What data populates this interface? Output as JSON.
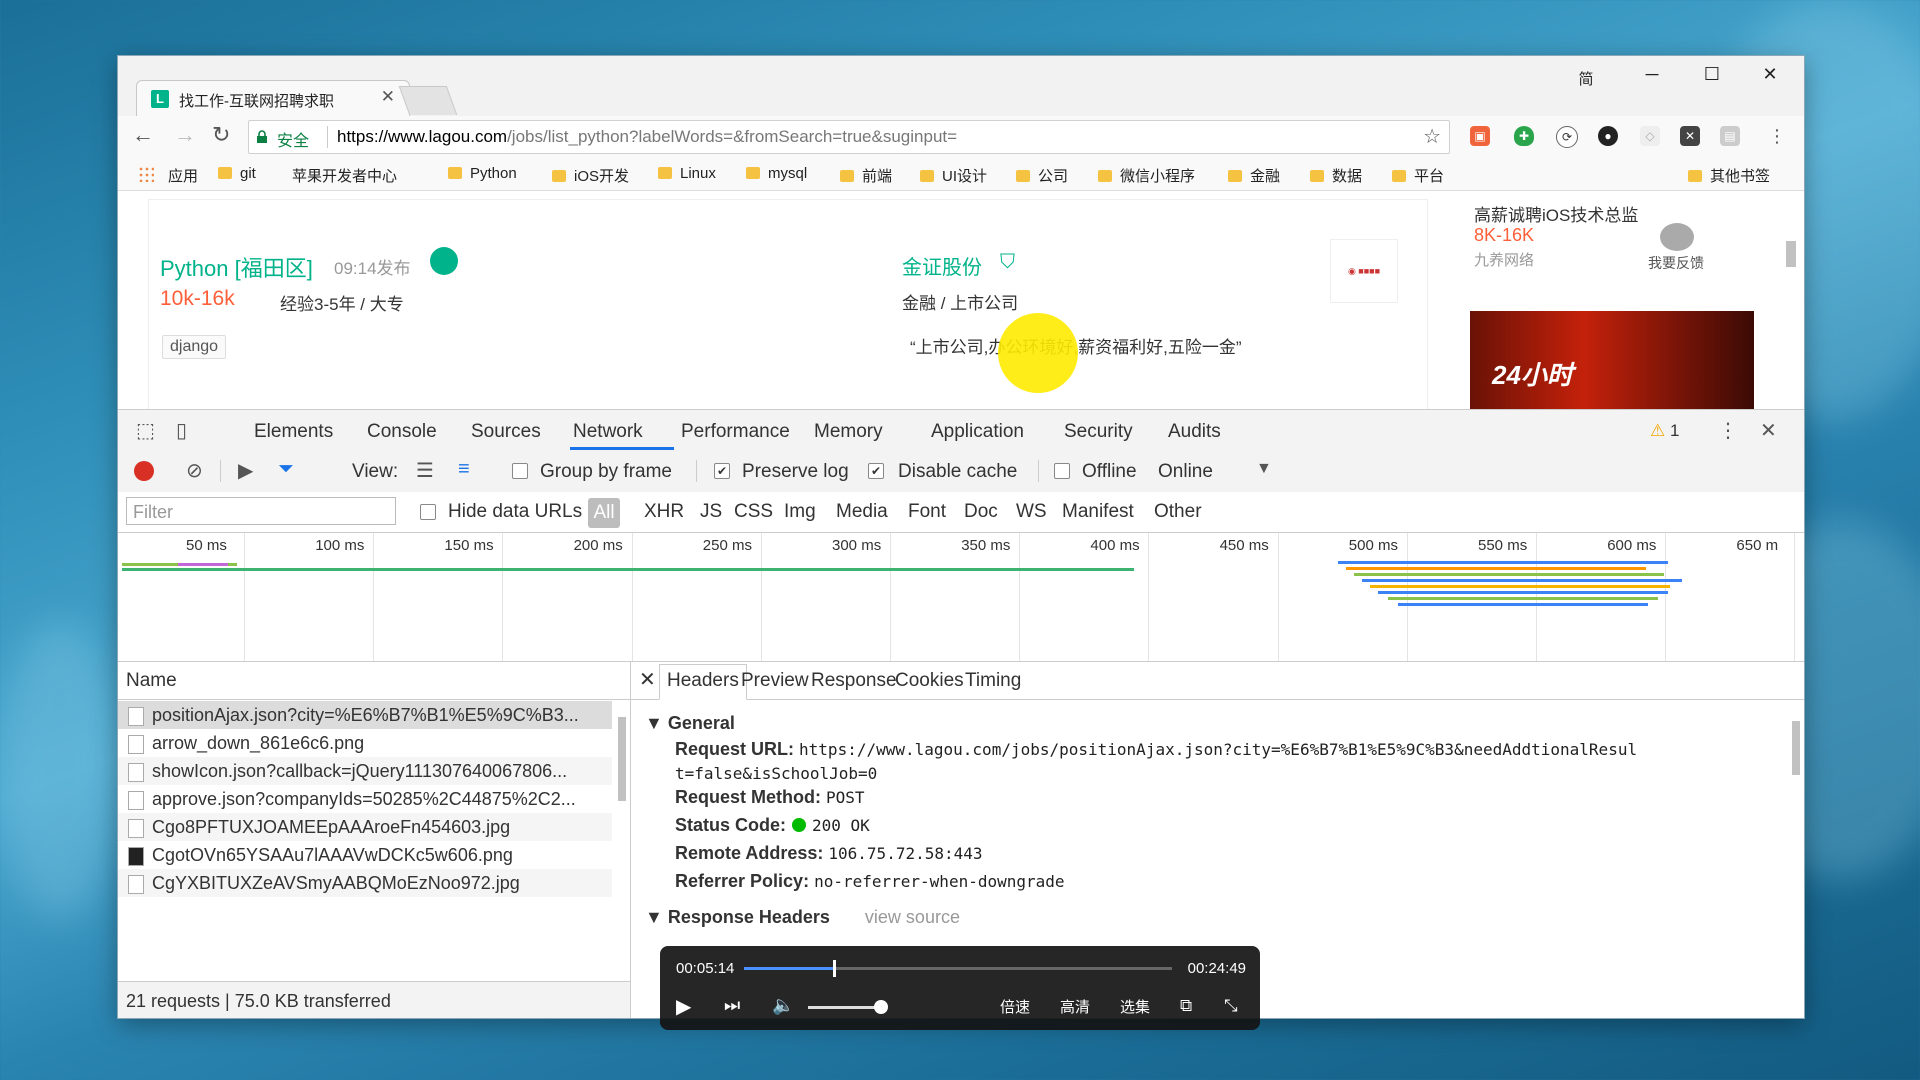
{
  "browser": {
    "tab_title": "找工作-互联网招聘求职",
    "tab_favicon": "L",
    "window_icon": "简",
    "url_secure_label": "安全",
    "url_domain": "https://www.lagou.com",
    "url_path": "/jobs/list_python?labelWords=&fromSearch=true&suginput="
  },
  "bookmarks": {
    "apps_label": "应用",
    "items": [
      "git",
      "苹果开发者中心",
      "Python",
      "iOS开发",
      "Linux",
      "mysql",
      "前端",
      "UI设计",
      "公司",
      "微信小程序",
      "金融",
      "数据",
      "平台"
    ],
    "other_label": "其他书签"
  },
  "page": {
    "job_title": "Python [福田区]",
    "job_time": "09:14发布",
    "salary": "10k-16k",
    "requirements": "经验3-5年 / 大专",
    "tag": "django",
    "company": "金证股份",
    "industry": "金融 / 上市公司",
    "quote": "“上市公司,办公环境好,薪资福利好,五险一金”",
    "side_job_title": "高薪诚聘iOS技术总监",
    "side_salary": "8K-16K",
    "side_company": "九养网络",
    "feedback_label": "我要反馈",
    "banner_text": "24小时"
  },
  "devtools": {
    "tabs": [
      "Elements",
      "Console",
      "Sources",
      "Network",
      "Performance",
      "Memory",
      "Application",
      "Security",
      "Audits"
    ],
    "active_tab": "Network",
    "warning_count": "1",
    "view_label": "View:",
    "group_by_frame": "Group by frame",
    "preserve_log": "Preserve log",
    "disable_cache": "Disable cache",
    "offline": "Offline",
    "online": "Online",
    "filter_placeholder": "Filter",
    "hide_data_urls": "Hide data URLs",
    "type_filters": [
      "All",
      "XHR",
      "JS",
      "CSS",
      "Img",
      "Media",
      "Font",
      "Doc",
      "WS",
      "Manifest",
      "Other"
    ],
    "timeline_ticks": [
      "50 ms",
      "100 ms",
      "150 ms",
      "200 ms",
      "250 ms",
      "300 ms",
      "350 ms",
      "400 ms",
      "450 ms",
      "500 ms",
      "550 ms",
      "600 ms",
      "650 m"
    ],
    "name_header": "Name",
    "requests": [
      "positionAjax.json?city=%E6%B7%B1%E5%9C%B3...",
      "arrow_down_861e6c6.png",
      "showIcon.json?callback=jQuery111307640067806...",
      "approve.json?companyIds=50285%2C44875%2C2...",
      "Cgo8PFTUXJOAMEEpAAAroeFn454603.jpg",
      "CgotOVn65YSAAu7lAAAVwDCKc5w606.png",
      "CgYXBITUXZeAVSmyAABQMoEzNoo972.jpg"
    ],
    "summary": "21 requests  |  75.0 KB transferred",
    "detail_tabs": [
      "Headers",
      "Preview",
      "Response",
      "Cookies",
      "Timing"
    ],
    "general_label": "General",
    "request_url_label": "Request URL:",
    "request_url_1": "https://www.lagou.com/jobs/positionAjax.json?city=%E6%B7%B1%E5%9C%B3&needAddtionalResul",
    "request_url_2": "t=false&isSchoolJob=0",
    "request_method_label": "Request Method:",
    "request_method": "POST",
    "status_code_label": "Status Code:",
    "status_code": "200 OK",
    "remote_address_label": "Remote Address:",
    "remote_address": "106.75.72.58:443",
    "referrer_policy_label": "Referrer Policy:",
    "referrer_policy": "no-referrer-when-downgrade",
    "response_headers_label": "Response Headers",
    "view_source": "view source"
  },
  "player": {
    "current_time": "00:05:14",
    "total_time": "00:24:49",
    "progress": 0.21,
    "speed_label": "倍速",
    "quality_label": "高清",
    "episodes_label": "选集"
  }
}
